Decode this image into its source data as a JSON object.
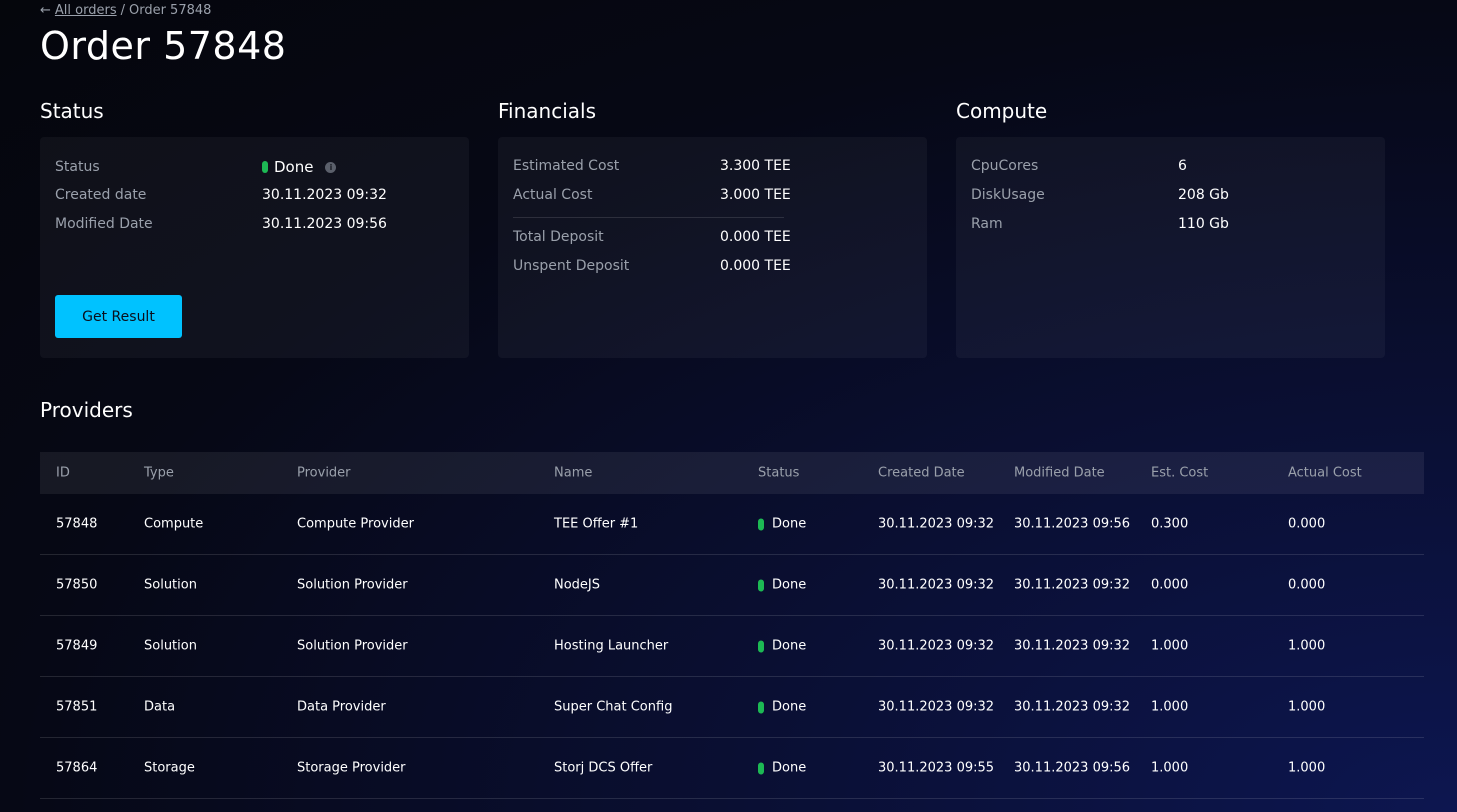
{
  "breadcrumb": {
    "arrow": "←",
    "parent_label": "All orders",
    "separator": "/",
    "current": "Order 57848"
  },
  "page_title": "Order 57848",
  "status_section": {
    "title": "Status",
    "rows": [
      {
        "label": "Status",
        "value": "Done"
      },
      {
        "label": "Created date",
        "value": "30.11.2023 09:32"
      },
      {
        "label": "Modified Date",
        "value": "30.11.2023 09:56"
      }
    ],
    "info_icon": "i",
    "button_label": "Get Result"
  },
  "financials_section": {
    "title": "Financials",
    "rows": [
      {
        "label": "Estimated Cost",
        "value": "3.300 TEE"
      },
      {
        "label": "Actual Cost",
        "value": "3.000 TEE"
      },
      {
        "label": "Total Deposit",
        "value": "0.000 TEE"
      },
      {
        "label": "Unspent Deposit",
        "value": "0.000 TEE"
      }
    ]
  },
  "compute_section": {
    "title": "Compute",
    "rows": [
      {
        "label": "CpuCores",
        "value": "6"
      },
      {
        "label": "DiskUsage",
        "value": "208 Gb"
      },
      {
        "label": "Ram",
        "value": "110 Gb"
      }
    ]
  },
  "providers": {
    "title": "Providers",
    "headers": [
      "ID",
      "Type",
      "Provider",
      "Name",
      "Status",
      "Created Date",
      "Modified Date",
      "Est. Cost",
      "Actual Cost"
    ],
    "rows": [
      {
        "id": "57848",
        "type": "Compute",
        "provider": "Compute Provider",
        "name": "TEE Offer #1",
        "status": "Done",
        "created": "30.11.2023 09:32",
        "modified": "30.11.2023 09:56",
        "est": "0.300",
        "actual": "0.000"
      },
      {
        "id": "57850",
        "type": "Solution",
        "provider": "Solution Provider",
        "name": "NodeJS",
        "status": "Done",
        "created": "30.11.2023 09:32",
        "modified": "30.11.2023 09:32",
        "est": "0.000",
        "actual": "0.000"
      },
      {
        "id": "57849",
        "type": "Solution",
        "provider": "Solution Provider",
        "name": "Hosting Launcher",
        "status": "Done",
        "created": "30.11.2023 09:32",
        "modified": "30.11.2023 09:32",
        "est": "1.000",
        "actual": "1.000"
      },
      {
        "id": "57851",
        "type": "Data",
        "provider": "Data Provider",
        "name": "Super Chat Config",
        "status": "Done",
        "created": "30.11.2023 09:32",
        "modified": "30.11.2023 09:32",
        "est": "1.000",
        "actual": "1.000"
      },
      {
        "id": "57864",
        "type": "Storage",
        "provider": "Storage Provider",
        "name": "Storj DCS Offer",
        "status": "Done",
        "created": "30.11.2023 09:55",
        "modified": "30.11.2023 09:56",
        "est": "1.000",
        "actual": "1.000"
      }
    ]
  },
  "colors": {
    "accent": "#00c2ff",
    "status_done": "#1db954"
  }
}
